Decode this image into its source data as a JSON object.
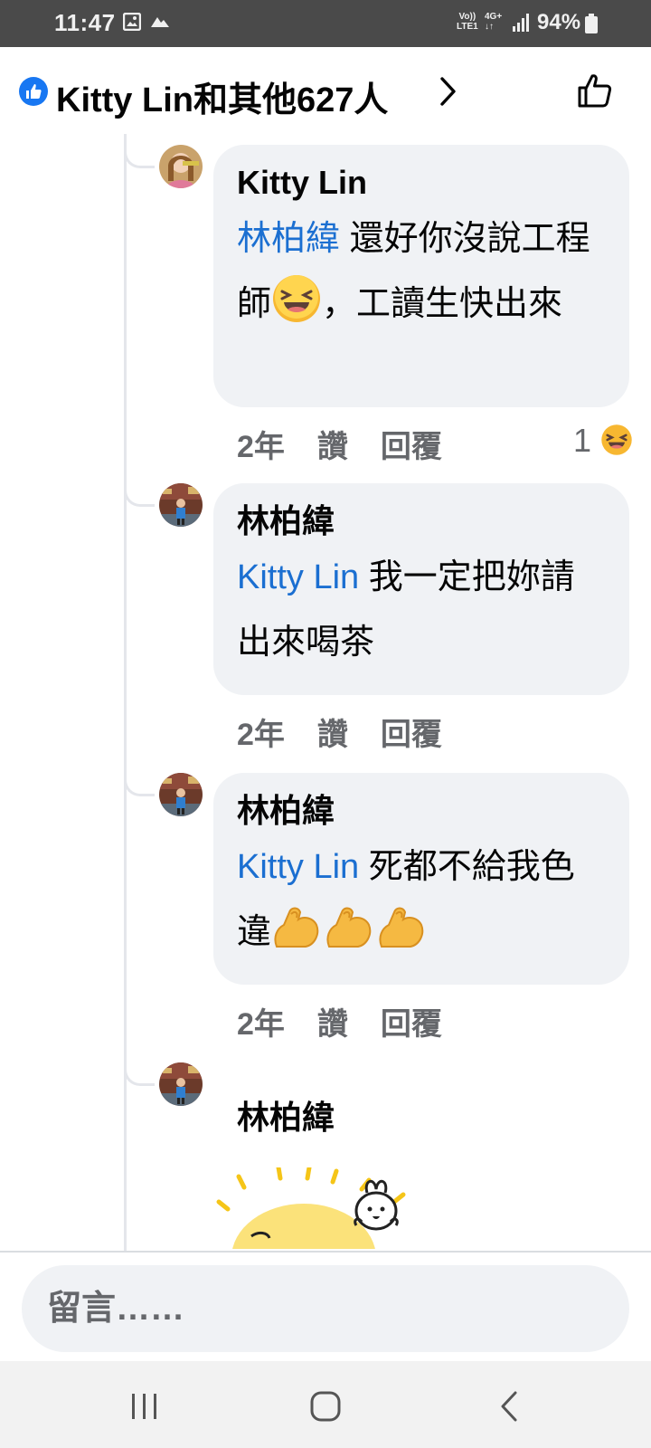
{
  "status_bar": {
    "time": "11:47",
    "network_top": "Vo))",
    "network_bottom": "LTE1",
    "network_type": "4G+",
    "battery": "94%"
  },
  "header": {
    "title": "Kitty Lin和其他627人",
    "accent_color": "#1877f2"
  },
  "comments": [
    {
      "author": "Kitty Lin",
      "mention": "林柏緯",
      "text_before_emoji": " 還好你沒說工程師",
      "text_after_emoji": "，工讀生快出來",
      "time": "2年",
      "like": "讚",
      "reply": "回覆",
      "reaction_count": "1",
      "reaction_icon": "laughing-emoji"
    },
    {
      "author": "林柏緯",
      "mention": "Kitty Lin",
      "text": " 我一定把妳請出來喝茶",
      "time": "2年",
      "like": "讚",
      "reply": "回覆"
    },
    {
      "author": "林柏緯",
      "mention": "Kitty Lin",
      "text": " 死都不給我色違",
      "emoji": "flexed-biceps-emoji x3",
      "time": "2年",
      "like": "讚",
      "reply": "回覆"
    },
    {
      "author": "林柏緯",
      "attachment": "sun-bunny-sticker"
    }
  ],
  "composer": {
    "placeholder": "留言……"
  },
  "nav": {
    "recent": "recent-apps-icon",
    "home": "home-icon",
    "back": "back-icon"
  }
}
